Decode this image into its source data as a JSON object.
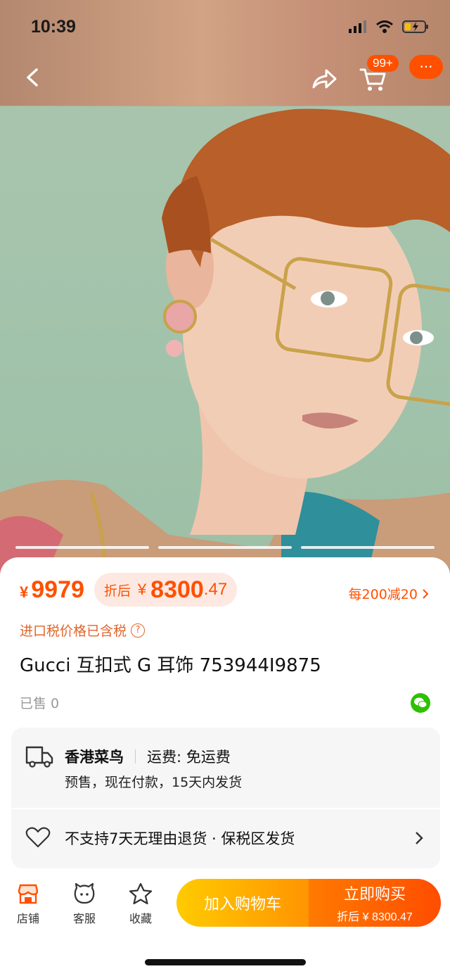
{
  "status_bar": {
    "time": "10:39"
  },
  "nav": {
    "cart_badge": "99+",
    "more_glyph": "···"
  },
  "gallery": {
    "page_count": 3,
    "active_index": 0
  },
  "price": {
    "currency": "¥",
    "original": "9979",
    "after_label": "折后",
    "after_int": "8300",
    "after_dec": ".47",
    "promo": "每200减20"
  },
  "tax_note": "进口税价格已含税",
  "product_title": "Gucci 互扣式 G 耳饰 753944I9875",
  "sold": "已售 0",
  "service": {
    "origin": "香港菜鸟",
    "shipping": "运费: 免运费",
    "presale": "预售，现在付款，15天内发货",
    "policy": "不支持7天无理由退货 · 保税区发货"
  },
  "bottom_bar": {
    "shop": "店铺",
    "service": "客服",
    "favorite": "收藏",
    "add_to_cart": "加入购物车",
    "buy_now": "立即购买",
    "buy_now_price": "折后 ¥ 8300.47"
  },
  "icons": [
    "back-icon",
    "share-icon",
    "cart-icon",
    "more-icon",
    "question-icon",
    "wechat-icon",
    "truck-icon",
    "heart-icon",
    "chevron-right-icon",
    "shop-icon",
    "customer-service-icon",
    "star-icon"
  ],
  "colors": {
    "accent": "#ff5000",
    "cart_button": "#ffb400",
    "buy_button": "#ff5a00",
    "wechat": "#2dc100"
  }
}
